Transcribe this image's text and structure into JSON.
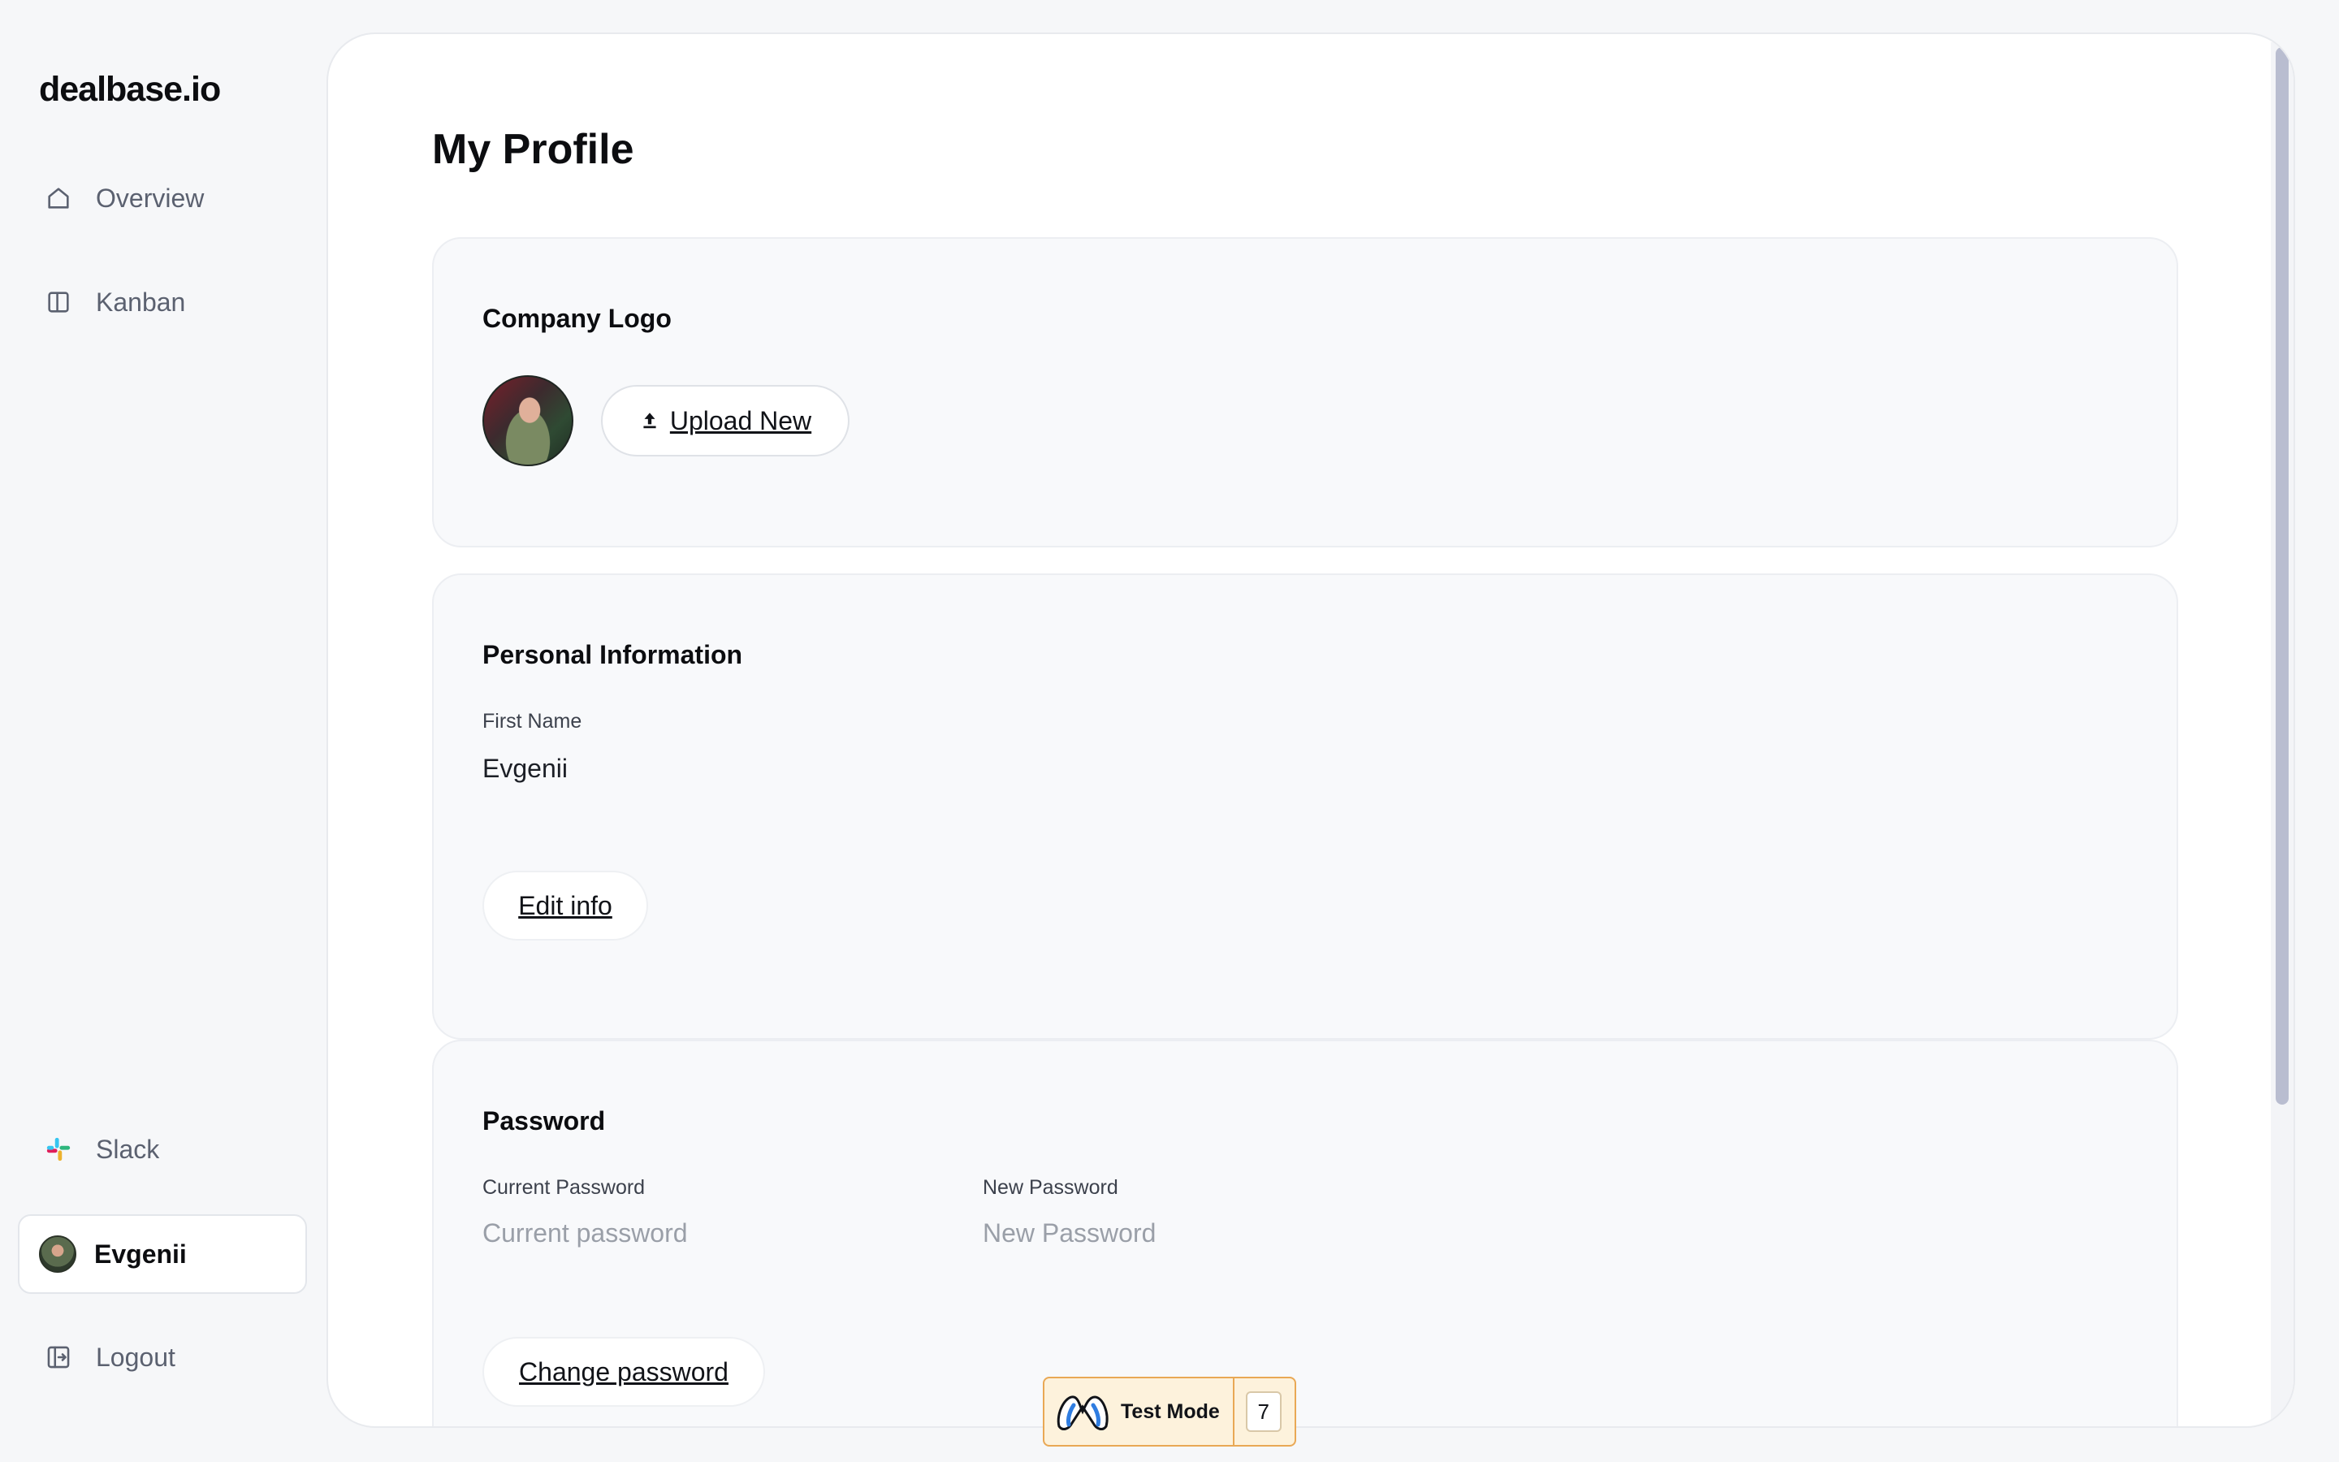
{
  "app": {
    "logo_text": "dealbase.io"
  },
  "sidebar": {
    "items": [
      {
        "label": "Overview",
        "icon": "home-icon"
      },
      {
        "label": "Kanban",
        "icon": "kanban-icon"
      },
      {
        "label": "Slack",
        "icon": "slack-icon"
      },
      {
        "label": "Evgenii",
        "icon": "avatar"
      },
      {
        "label": "Logout",
        "icon": "logout-icon"
      }
    ]
  },
  "main": {
    "title": "My Profile",
    "company_logo": {
      "title": "Company Logo",
      "upload_label": "Upload New"
    },
    "personal_info": {
      "title": "Personal Information",
      "first_name_label": "First Name",
      "first_name_value": "Evgenii",
      "edit_label": "Edit info"
    },
    "password": {
      "title": "Password",
      "current_label": "Current Password",
      "current_placeholder": "Current password",
      "new_label": "New Password",
      "new_placeholder": "New Password",
      "change_label": "Change password"
    }
  },
  "test_mode": {
    "label": "Test Mode",
    "count": "7"
  },
  "colors": {
    "accent_border": "#e9a855",
    "scroll_thumb": "#b9bdd0"
  }
}
